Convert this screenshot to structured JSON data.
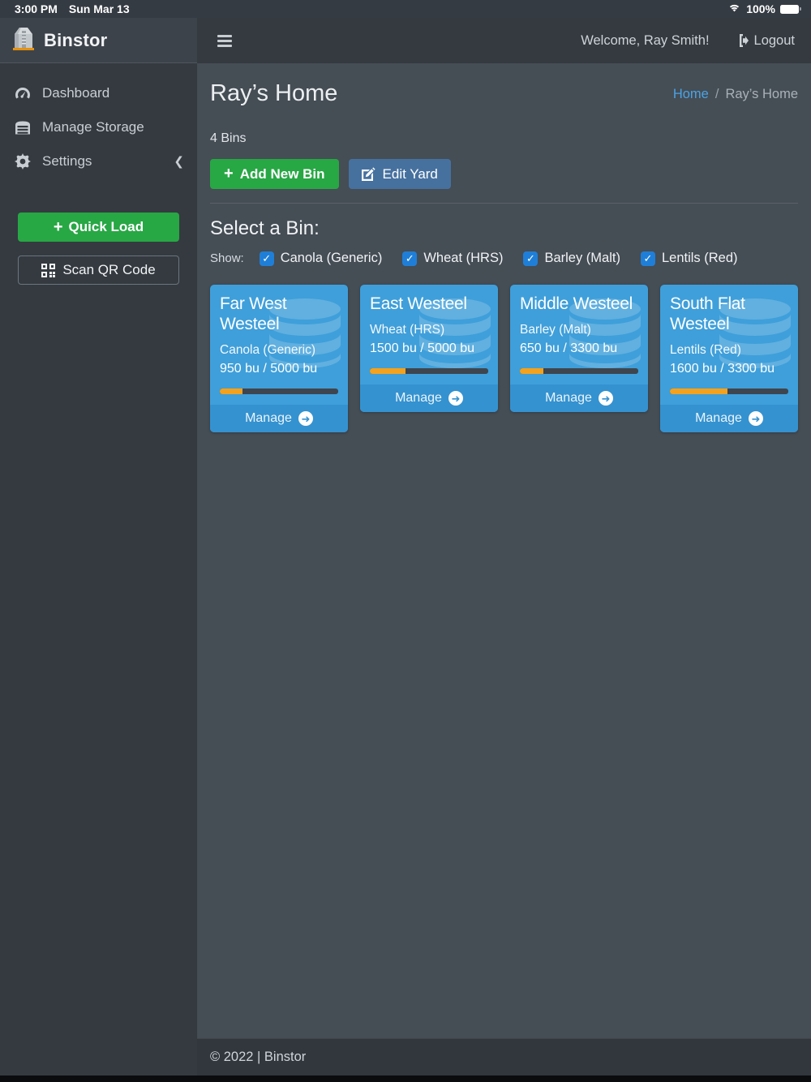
{
  "status_bar": {
    "time": "3:00 PM",
    "date": "Sun Mar 13",
    "battery": "100%"
  },
  "sidebar": {
    "brand": "Binstor",
    "items": [
      {
        "label": "Dashboard"
      },
      {
        "label": "Manage Storage"
      },
      {
        "label": "Settings"
      }
    ],
    "quick_load_label": "Quick Load",
    "scan_qr_label": "Scan QR Code"
  },
  "header": {
    "welcome": "Welcome, Ray Smith!",
    "logout_label": "Logout"
  },
  "page": {
    "title": "Ray’s Home",
    "breadcrumb": {
      "home": "Home",
      "separator": "/",
      "current": "Ray’s Home"
    },
    "bin_count": "4 Bins",
    "add_new_bin_label": "Add New Bin",
    "edit_yard_label": "Edit Yard",
    "select_heading": "Select a Bin:",
    "show_label": "Show:",
    "manage_label": "Manage",
    "filters": [
      {
        "label": "Canola (Generic)",
        "checked": true
      },
      {
        "label": "Wheat (HRS)",
        "checked": true
      },
      {
        "label": "Barley (Malt)",
        "checked": true
      },
      {
        "label": "Lentils (Red)",
        "checked": true
      }
    ]
  },
  "bins": [
    {
      "name": "Far West Westeel",
      "commodity": "Canola (Generic)",
      "quantity": "950 bu / 5000 bu",
      "percent": 19
    },
    {
      "name": "East Westeel",
      "commodity": "Wheat (HRS)",
      "quantity": "1500 bu / 5000 bu",
      "percent": 30
    },
    {
      "name": "Middle Westeel",
      "commodity": "Barley (Malt)",
      "quantity": "650 bu / 3300 bu",
      "percent": 19.7
    },
    {
      "name": "South Flat Westeel",
      "commodity": "Lentils (Red)",
      "quantity": "1600 bu / 3300 bu",
      "percent": 48.5
    }
  ],
  "footer": {
    "copyright": "© 2022 | Binstor"
  },
  "colors": {
    "accent_blue": "#3f9fda",
    "progress_orange": "#f4a21d",
    "success_green": "#28a745",
    "link_blue": "#4ba3e3",
    "checkbox_blue": "#1f7fd8"
  }
}
